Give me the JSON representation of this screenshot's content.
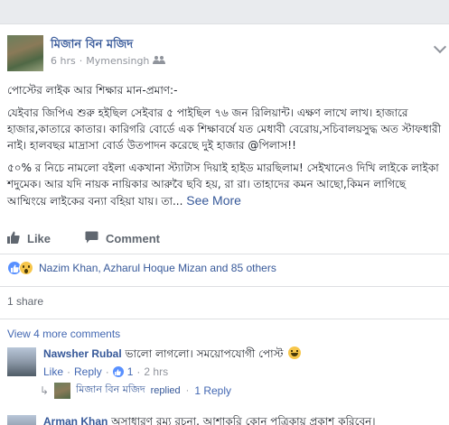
{
  "post": {
    "author": "মিজান বিন মজিদ",
    "time": "6 hrs",
    "location": "Mymensingh",
    "paragraphs": [
      "পোস্টের লাইক আর শিক্ষার মান-প্রমাণ:-",
      "যেইবার জিপিএ শুরু হইছিল সেইবার ৫ পাইছিল ৭৬ জন রিলিয়ান্ট। এক্ষণ লাখে লাখ। হাজারে হাজার,কাতারে কাতার। কারিগরি বোর্ডে এক শিক্ষাবর্ষে যত মেধাবী বেরোয়,সচিবালয়সুদ্ধ অত স্টাফধারী নাই। হালবছর মাদ্রাসা বোর্ড উতপাদন করেছে দুই হাজার @পিলাস!!",
      "৫০% র নিচে নামলো বইলা একখানা স্ট্যাটাস দিয়াই হাইড মারছিলাম! সেইখানেও দিখি লাইকে লাইকা শদুমেক। আর যদি নায়ক নায়িকার আরুবৈ ছবি হয়, রা রা। তাহাদের কমন আছো,কিমন লাগিছে আম্মিংয়ে লাইকের বন্যা বহিয়া যায়। তা..."
    ],
    "see_more": "See More"
  },
  "actions": {
    "like": "Like",
    "comment": "Comment"
  },
  "reactions": {
    "summary": "Nazim Khan, Azharul Hoque Mizan and 85 others"
  },
  "shares": "1 share",
  "view_more_comments": "View 4 more comments",
  "comments": [
    {
      "author": "Nawsher Rubal",
      "text": "ভালো লাগলো। সময়োপযোগী পোস্ট",
      "like": "Like",
      "reply": "Reply",
      "likes_count": "1",
      "time": "2 hrs"
    },
    {
      "author": "Arman Khan",
      "text": "অসাধারণ রম্য রচনা. আশাকরি কোন পত্রিকায় প্রকাশ করিবেন।"
    }
  ],
  "reply_summary": {
    "author": "মিজান বিন মজিদ",
    "action": "replied",
    "count": "1 Reply"
  },
  "colors": {
    "link": "#365899",
    "muted": "#90949c",
    "like_blue": "#5890ff"
  }
}
